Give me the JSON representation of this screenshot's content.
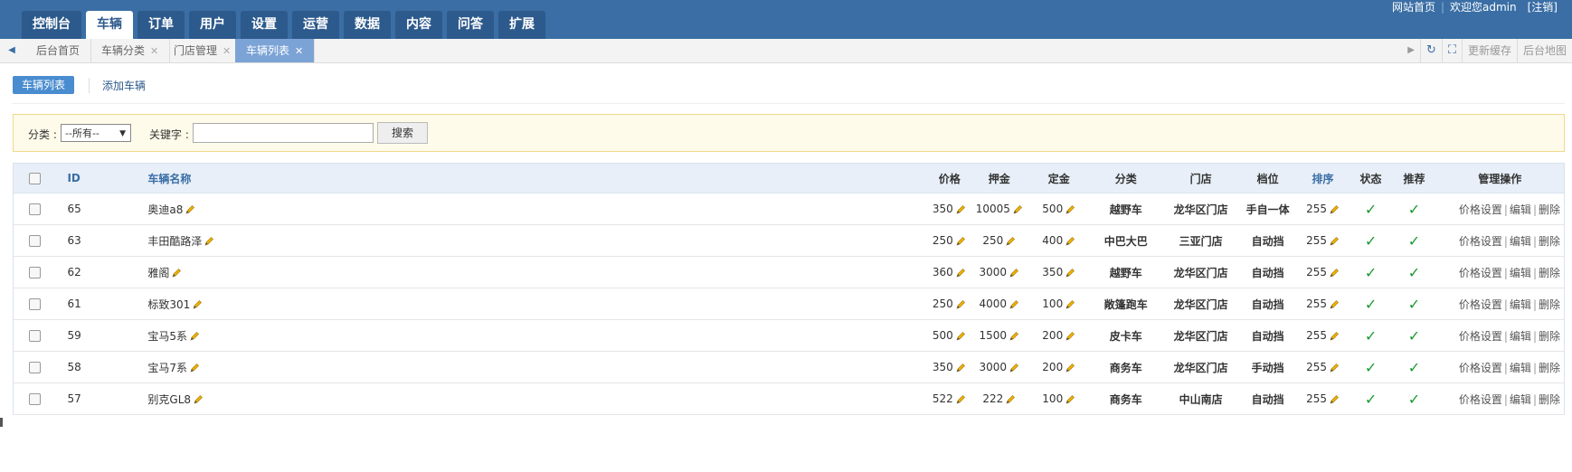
{
  "nav": {
    "tabs": [
      "控制台",
      "车辆",
      "订单",
      "用户",
      "设置",
      "运营",
      "数据",
      "内容",
      "问答",
      "扩展"
    ],
    "active_index": 1,
    "links": {
      "home": "网站首页",
      "welcome": "欢迎您admin",
      "logout": "[注销]"
    }
  },
  "tabstrip": {
    "tabs": [
      {
        "label": "后台首页",
        "closable": false
      },
      {
        "label": "车辆分类",
        "closable": true
      },
      {
        "label": "门店管理",
        "closable": true
      },
      {
        "label": "车辆列表",
        "closable": true
      }
    ],
    "active_index": 3,
    "right": {
      "refresh_cache": "更新缓存",
      "site_map": "后台地图"
    }
  },
  "subtabs": {
    "list": "车辆列表",
    "add": "添加车辆"
  },
  "search": {
    "category_label": "分类 :",
    "category_value": "--所有--",
    "keyword_label": "关键字 :",
    "keyword_value": "",
    "button": "搜索"
  },
  "table": {
    "headers": {
      "id": "ID",
      "name": "车辆名称",
      "price": "价格",
      "deposit": "押金",
      "down_payment": "定金",
      "category": "分类",
      "store": "门店",
      "gear": "档位",
      "sort": "排序",
      "status": "状态",
      "recommend": "推荐",
      "ops": "管理操作"
    },
    "ops_labels": {
      "price": "价格设置",
      "edit": "编辑",
      "delete": "删除"
    },
    "rows": [
      {
        "id": "65",
        "name": "奥迪a8",
        "price": "350",
        "deposit": "10005",
        "down": "500",
        "category": "越野车",
        "store": "龙华区门店",
        "gear": "手自一体",
        "sort": "255"
      },
      {
        "id": "63",
        "name": "丰田酷路泽",
        "price": "250",
        "deposit": "250",
        "down": "400",
        "category": "中巴大巴",
        "store": "三亚门店",
        "gear": "自动挡",
        "sort": "255"
      },
      {
        "id": "62",
        "name": "雅阁",
        "price": "360",
        "deposit": "3000",
        "down": "350",
        "category": "越野车",
        "store": "龙华区门店",
        "gear": "自动挡",
        "sort": "255"
      },
      {
        "id": "61",
        "name": "标致301",
        "price": "250",
        "deposit": "4000",
        "down": "100",
        "category": "敞篷跑车",
        "store": "龙华区门店",
        "gear": "自动挡",
        "sort": "255"
      },
      {
        "id": "59",
        "name": "宝马5系",
        "price": "500",
        "deposit": "1500",
        "down": "200",
        "category": "皮卡车",
        "store": "龙华区门店",
        "gear": "自动挡",
        "sort": "255"
      },
      {
        "id": "58",
        "name": "宝马7系",
        "price": "350",
        "deposit": "3000",
        "down": "200",
        "category": "商务车",
        "store": "龙华区门店",
        "gear": "手动挡",
        "sort": "255"
      },
      {
        "id": "57",
        "name": "别克GL8",
        "price": "522",
        "deposit": "222",
        "down": "100",
        "category": "商务车",
        "store": "中山南店",
        "gear": "自动挡",
        "sort": "255"
      }
    ]
  },
  "colors": {
    "nav_bg": "#3a6ea5",
    "active_tab_bg": "#7ba3d6",
    "check_green": "#1a9a2f"
  }
}
